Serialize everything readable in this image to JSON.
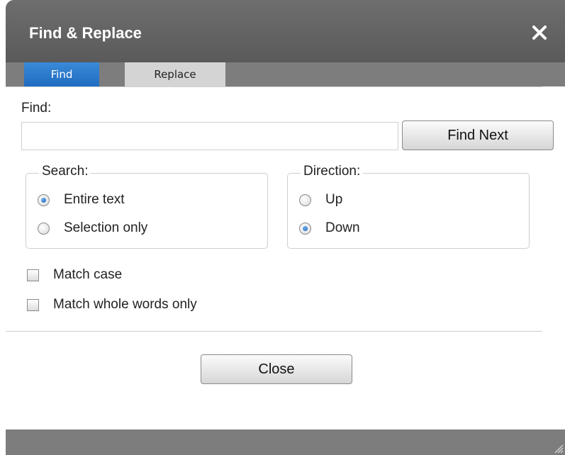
{
  "dialog": {
    "title": "Find & Replace",
    "close_icon": "close-icon"
  },
  "tabs": [
    {
      "label": "Find",
      "active": true
    },
    {
      "label": "Replace",
      "active": false
    }
  ],
  "find": {
    "label": "Find:",
    "value": "",
    "find_next_label": "Find Next"
  },
  "search_group": {
    "legend": "Search:",
    "options": [
      {
        "label": "Entire text",
        "checked": true
      },
      {
        "label": "Selection only",
        "checked": false
      }
    ]
  },
  "direction_group": {
    "legend": "Direction:",
    "options": [
      {
        "label": "Up",
        "checked": false
      },
      {
        "label": "Down",
        "checked": true
      }
    ]
  },
  "checkboxes": [
    {
      "label": "Match case",
      "checked": false
    },
    {
      "label": "Match whole words only",
      "checked": false
    }
  ],
  "footer": {
    "close_label": "Close"
  },
  "colors": {
    "titlebar": "#5f5f5f",
    "active_tab": "#2a7ad0",
    "inactive_tab": "#d4d4d4",
    "radio_selected": "#1a5fb4"
  }
}
